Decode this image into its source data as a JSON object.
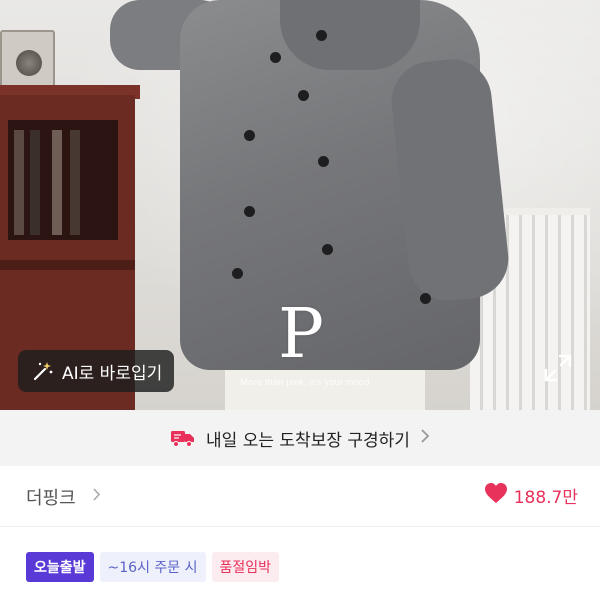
{
  "hero": {
    "watermark_letter": "P",
    "watermark_tagline": "More than pink, it's your mood",
    "ai_button_label": "AI로 바로입기",
    "icons": {
      "ai": "magic-wand-icon",
      "expand": "expand-icon"
    }
  },
  "delivery_banner": {
    "label": "내일 오는 도착보장 구경하기",
    "icon": "truck-icon",
    "accent_color": "#e8315b"
  },
  "store": {
    "name": "더핑크",
    "like_count": "188.7만",
    "like_color": "#e8315b"
  },
  "badges": {
    "today_ship": "오늘출발",
    "cutoff": "~16시 주문 시",
    "soldout_soon": "품절임박"
  },
  "colors": {
    "badge_today_bg": "#5a3ad7",
    "badge_cutoff_text": "#5a62c8",
    "badge_soldout_text": "#e8315b"
  }
}
